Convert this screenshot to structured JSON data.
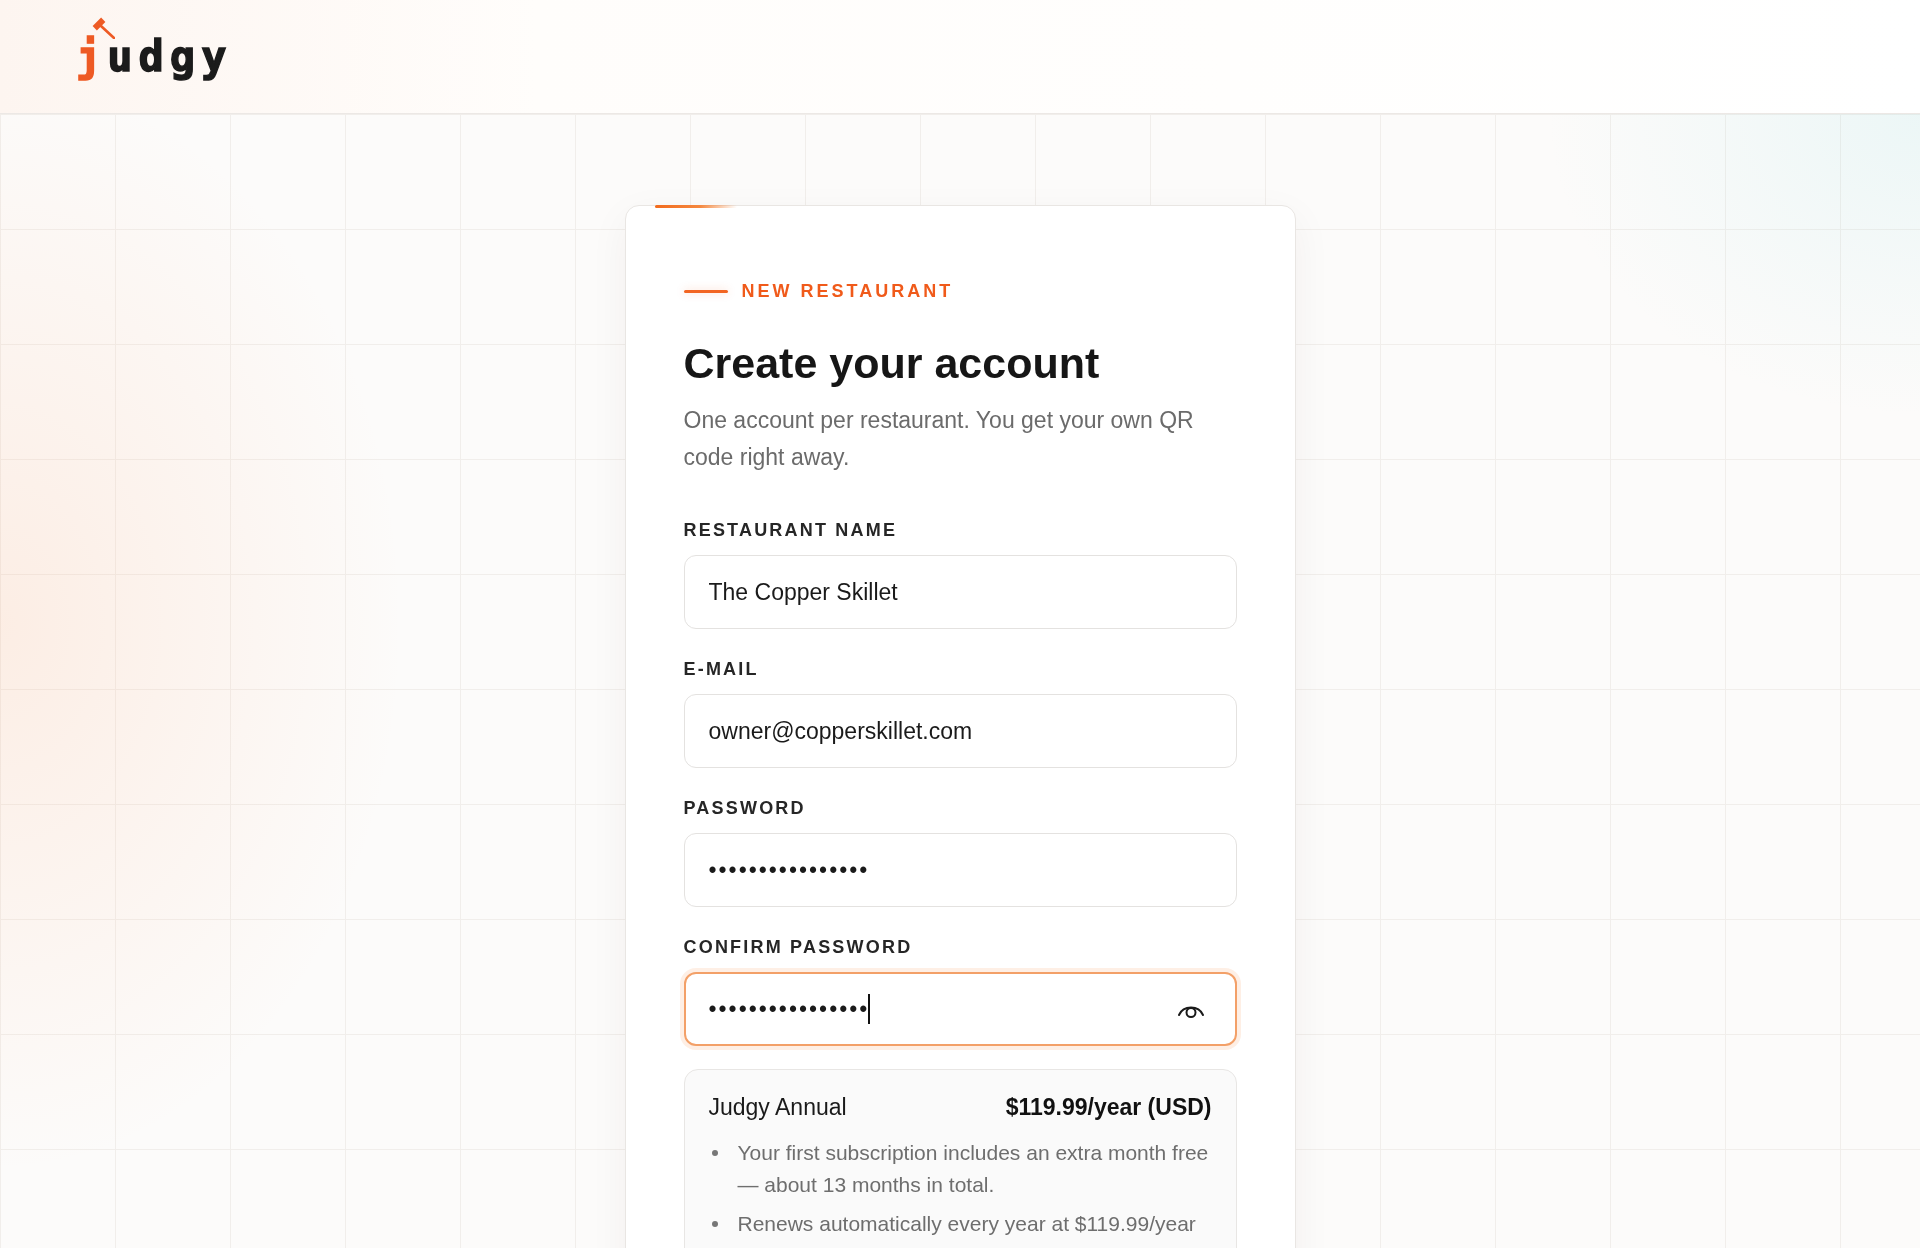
{
  "header": {
    "logo": "judgy"
  },
  "card": {
    "eyebrow": "NEW RESTAURANT",
    "title": "Create your account",
    "subtitle": "One account per restaurant. You get your own QR code right away.",
    "fields": [
      {
        "label": "RESTAURANT NAME",
        "kind": "text",
        "value": "The Copper Skillet",
        "focused": false
      },
      {
        "label": "E-MAIL",
        "kind": "text",
        "value": "owner@copperskillet.com",
        "focused": false
      },
      {
        "label": "PASSWORD",
        "kind": "password",
        "value": "••••••••••••••••",
        "focused": false
      },
      {
        "label": "CONFIRM PASSWORD",
        "kind": "password",
        "value": "••••••••••••••••",
        "focused": true
      }
    ],
    "plan": {
      "name": "Judgy Annual",
      "price": "$119.99/year (USD)",
      "notes": [
        "Your first subscription includes an extra month free — about 13 months in total.",
        "Renews automatically every year at $119.99/year"
      ]
    }
  }
}
